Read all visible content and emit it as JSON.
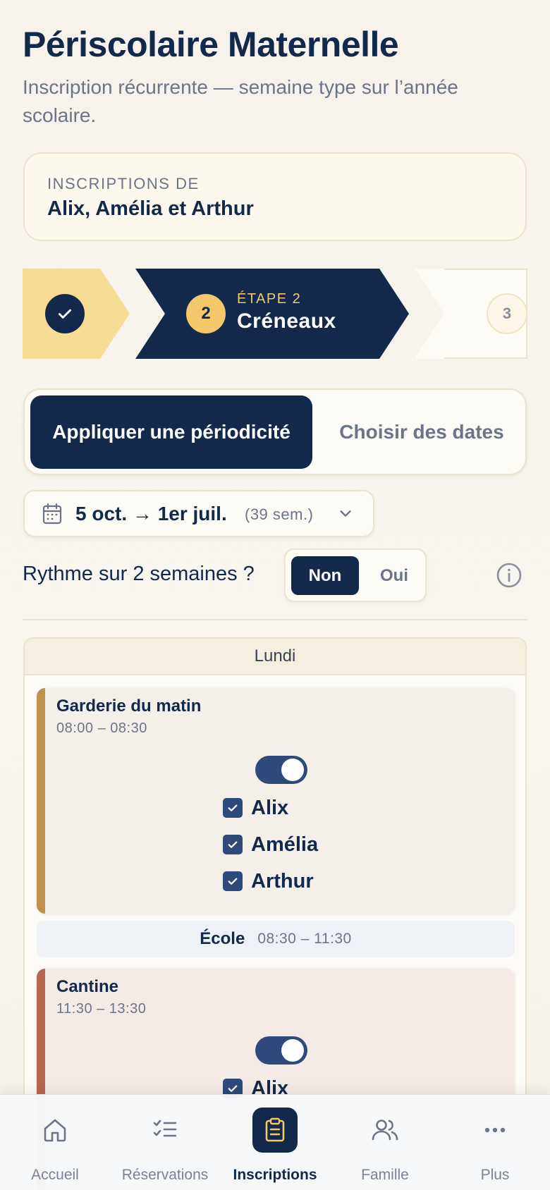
{
  "header": {
    "title": "Périscolaire Maternelle",
    "subtitle": "Inscription récurrente — semaine type sur l’année scolaire."
  },
  "registrants": {
    "label": "INSCRIPTIONS DE",
    "names": "Alix, Amélia et Arthur"
  },
  "stepper": {
    "steps": [
      {
        "number": "1",
        "state": "done",
        "icon": "check-icon"
      },
      {
        "number": "2",
        "state": "active",
        "kicker": "ÉTAPE 2",
        "name": "Créneaux"
      },
      {
        "number": "3",
        "state": "upcoming"
      }
    ]
  },
  "mode": {
    "options": [
      {
        "label": "Appliquer une périodicité",
        "selected": true
      },
      {
        "label": "Choisir des dates",
        "selected": false
      }
    ]
  },
  "date_range": {
    "icon": "calendar-icon",
    "range": "5 oct. → 1er juil.",
    "weeks": "(39 sem.)"
  },
  "rhythm": {
    "label": "Rythme sur 2 semaines ?",
    "options": [
      {
        "label": "Non",
        "selected": true
      },
      {
        "label": "Oui",
        "selected": false
      }
    ]
  },
  "day": {
    "name": "Lundi",
    "slots": [
      {
        "name": "Garderie du matin",
        "time": "08:00 – 08:30",
        "accent": "#c0914a",
        "background": "#f4efe8",
        "enabled": true,
        "children": [
          {
            "name": "Alix",
            "checked": true
          },
          {
            "name": "Amélia",
            "checked": true
          },
          {
            "name": "Arthur",
            "checked": true
          }
        ]
      },
      {
        "name": "Cantine",
        "time": "11:30 – 13:30",
        "accent": "#b9684f",
        "background": "#f4ebe6",
        "enabled": true,
        "children": [
          {
            "name": "Alix",
            "checked": true
          }
        ]
      }
    ],
    "school": {
      "name": "École",
      "time": "08:30 – 11:30"
    }
  },
  "nav": {
    "items": [
      {
        "label": "Accueil",
        "icon": "home-icon",
        "active": false
      },
      {
        "label": "Réservations",
        "icon": "checklist-icon",
        "active": false
      },
      {
        "label": "Inscriptions",
        "icon": "clipboard-icon",
        "active": true
      },
      {
        "label": "Famille",
        "icon": "users-icon",
        "active": false
      },
      {
        "label": "Plus",
        "icon": "more-icon",
        "active": false
      }
    ]
  },
  "colors": {
    "navy": "#13294b",
    "gold": "#f3c86a",
    "step_done": "#f6dc95",
    "muted": "#6b7489"
  }
}
